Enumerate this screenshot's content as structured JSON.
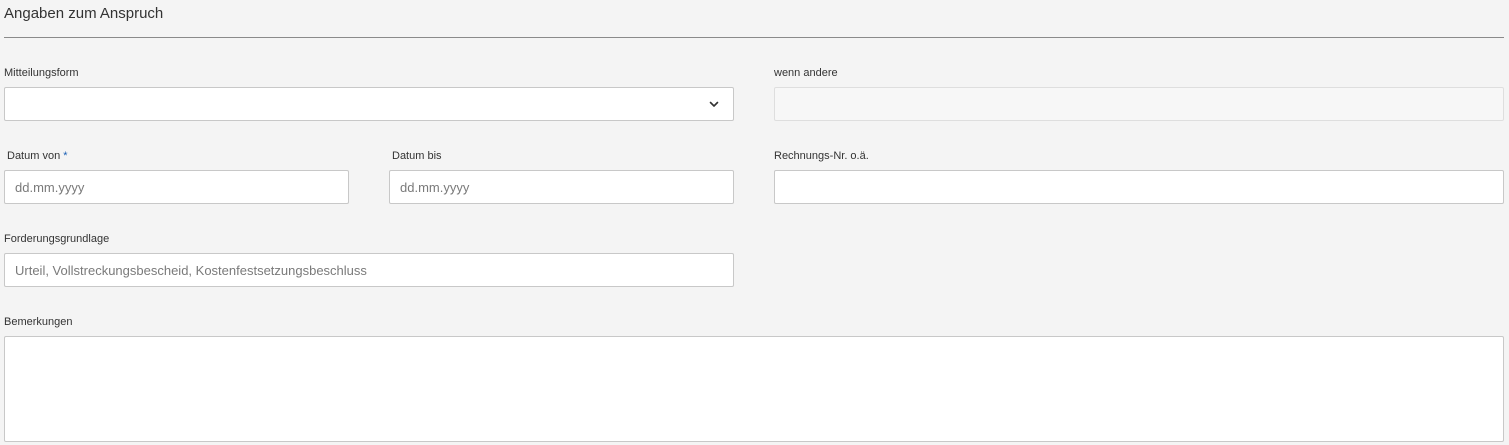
{
  "section": {
    "title": "Angaben zum Anspruch"
  },
  "mitteilungsform": {
    "label": "Mitteilungsform",
    "selected": ""
  },
  "wenn_andere": {
    "label": "wenn andere",
    "value": ""
  },
  "datum_von": {
    "label": "Datum von",
    "required_marker": "*",
    "placeholder": "dd.mm.yyyy"
  },
  "datum_bis": {
    "label": "Datum bis",
    "placeholder": "dd.mm.yyyy"
  },
  "rechnungs_nr": {
    "label": "Rechnungs-Nr. o.ä.",
    "value": ""
  },
  "forderungsgrundlage": {
    "label": "Forderungsgrundlage",
    "placeholder": "Urteil, Vollstreckungsbescheid, Kostenfestsetzungsbeschluss"
  },
  "bemerkungen": {
    "label": "Bemerkungen",
    "value": ""
  },
  "colors": {
    "background": "#f4f4f4",
    "required_marker": "#1a5fb4",
    "border": "#c8c8c8"
  }
}
